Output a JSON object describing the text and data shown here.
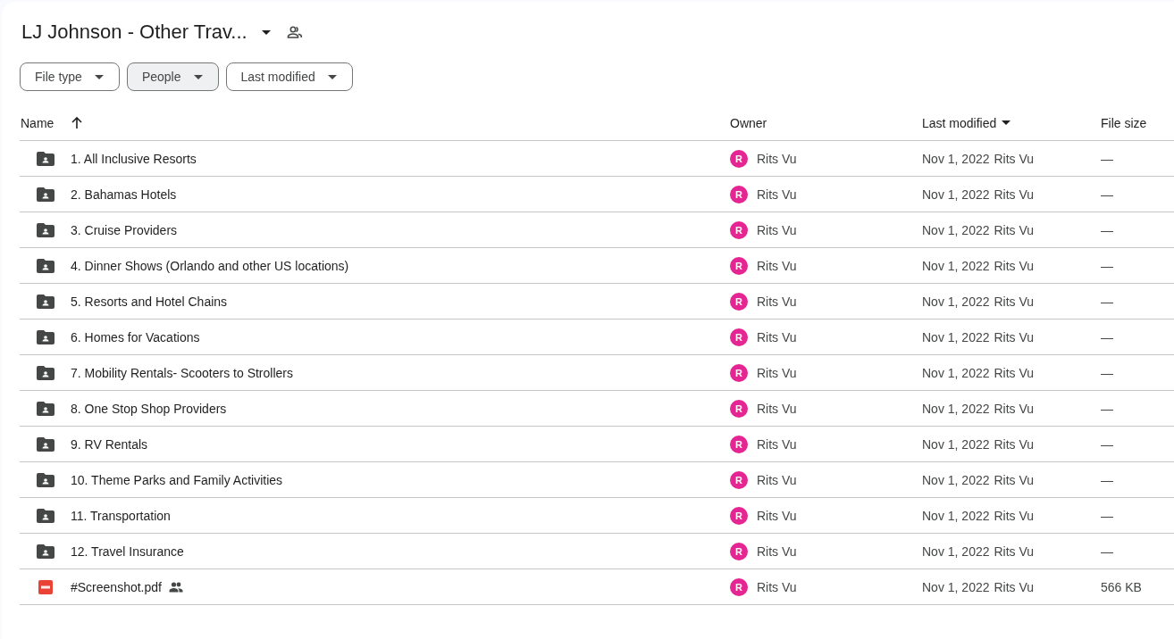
{
  "header": {
    "title": "LJ Johnson - Other Trav...",
    "shared": true
  },
  "filters": [
    {
      "label": "File type",
      "selected": false
    },
    {
      "label": "People",
      "selected": true
    },
    {
      "label": "Last modified",
      "selected": false
    }
  ],
  "table": {
    "columns": [
      {
        "label": "Name",
        "sorted": true,
        "menu": false
      },
      {
        "label": "Owner",
        "sorted": false,
        "menu": false
      },
      {
        "label": "Last modified",
        "sorted": false,
        "menu": true
      },
      {
        "label": "File size",
        "sorted": false,
        "menu": false
      }
    ],
    "rows": [
      {
        "kind": "folder",
        "name": "1. All Inclusive Resorts",
        "shared": false,
        "owner_initial": "R",
        "owner": "Rits Vu",
        "modified": "Nov 1, 2022",
        "modified_by": "Rits Vu",
        "size": "—"
      },
      {
        "kind": "folder",
        "name": "2. Bahamas Hotels",
        "shared": false,
        "owner_initial": "R",
        "owner": "Rits Vu",
        "modified": "Nov 1, 2022",
        "modified_by": "Rits Vu",
        "size": "—"
      },
      {
        "kind": "folder",
        "name": "3. Cruise Providers",
        "shared": false,
        "owner_initial": "R",
        "owner": "Rits Vu",
        "modified": "Nov 1, 2022",
        "modified_by": "Rits Vu",
        "size": "—"
      },
      {
        "kind": "folder",
        "name": "4. Dinner Shows (Orlando and other US locations)",
        "shared": false,
        "owner_initial": "R",
        "owner": "Rits Vu",
        "modified": "Nov 1, 2022",
        "modified_by": "Rits Vu",
        "size": "—"
      },
      {
        "kind": "folder",
        "name": "5. Resorts and Hotel Chains",
        "shared": false,
        "owner_initial": "R",
        "owner": "Rits Vu",
        "modified": "Nov 1, 2022",
        "modified_by": "Rits Vu",
        "size": "—"
      },
      {
        "kind": "folder",
        "name": "6. Homes for Vacations",
        "shared": false,
        "owner_initial": "R",
        "owner": "Rits Vu",
        "modified": "Nov 1, 2022",
        "modified_by": "Rits Vu",
        "size": "—"
      },
      {
        "kind": "folder",
        "name": "7. Mobility Rentals- Scooters to Strollers",
        "shared": false,
        "owner_initial": "R",
        "owner": "Rits Vu",
        "modified": "Nov 1, 2022",
        "modified_by": "Rits Vu",
        "size": "—"
      },
      {
        "kind": "folder",
        "name": "8. One Stop Shop Providers",
        "shared": false,
        "owner_initial": "R",
        "owner": "Rits Vu",
        "modified": "Nov 1, 2022",
        "modified_by": "Rits Vu",
        "size": "—"
      },
      {
        "kind": "folder",
        "name": "9. RV Rentals",
        "shared": false,
        "owner_initial": "R",
        "owner": "Rits Vu",
        "modified": "Nov 1, 2022",
        "modified_by": "Rits Vu",
        "size": "—"
      },
      {
        "kind": "folder",
        "name": "10. Theme Parks and Family Activities",
        "shared": false,
        "owner_initial": "R",
        "owner": "Rits Vu",
        "modified": "Nov 1, 2022",
        "modified_by": "Rits Vu",
        "size": "—"
      },
      {
        "kind": "folder",
        "name": "11. Transportation",
        "shared": false,
        "owner_initial": "R",
        "owner": "Rits Vu",
        "modified": "Nov 1, 2022",
        "modified_by": "Rits Vu",
        "size": "—"
      },
      {
        "kind": "folder",
        "name": "12. Travel Insurance",
        "shared": false,
        "owner_initial": "R",
        "owner": "Rits Vu",
        "modified": "Nov 1, 2022",
        "modified_by": "Rits Vu",
        "size": "—"
      },
      {
        "kind": "pdf",
        "name": "#Screenshot.pdf",
        "shared": true,
        "owner_initial": "R",
        "owner": "Rits Vu",
        "modified": "Nov 1, 2022",
        "modified_by": "Rits Vu",
        "size": "566 KB"
      }
    ]
  }
}
